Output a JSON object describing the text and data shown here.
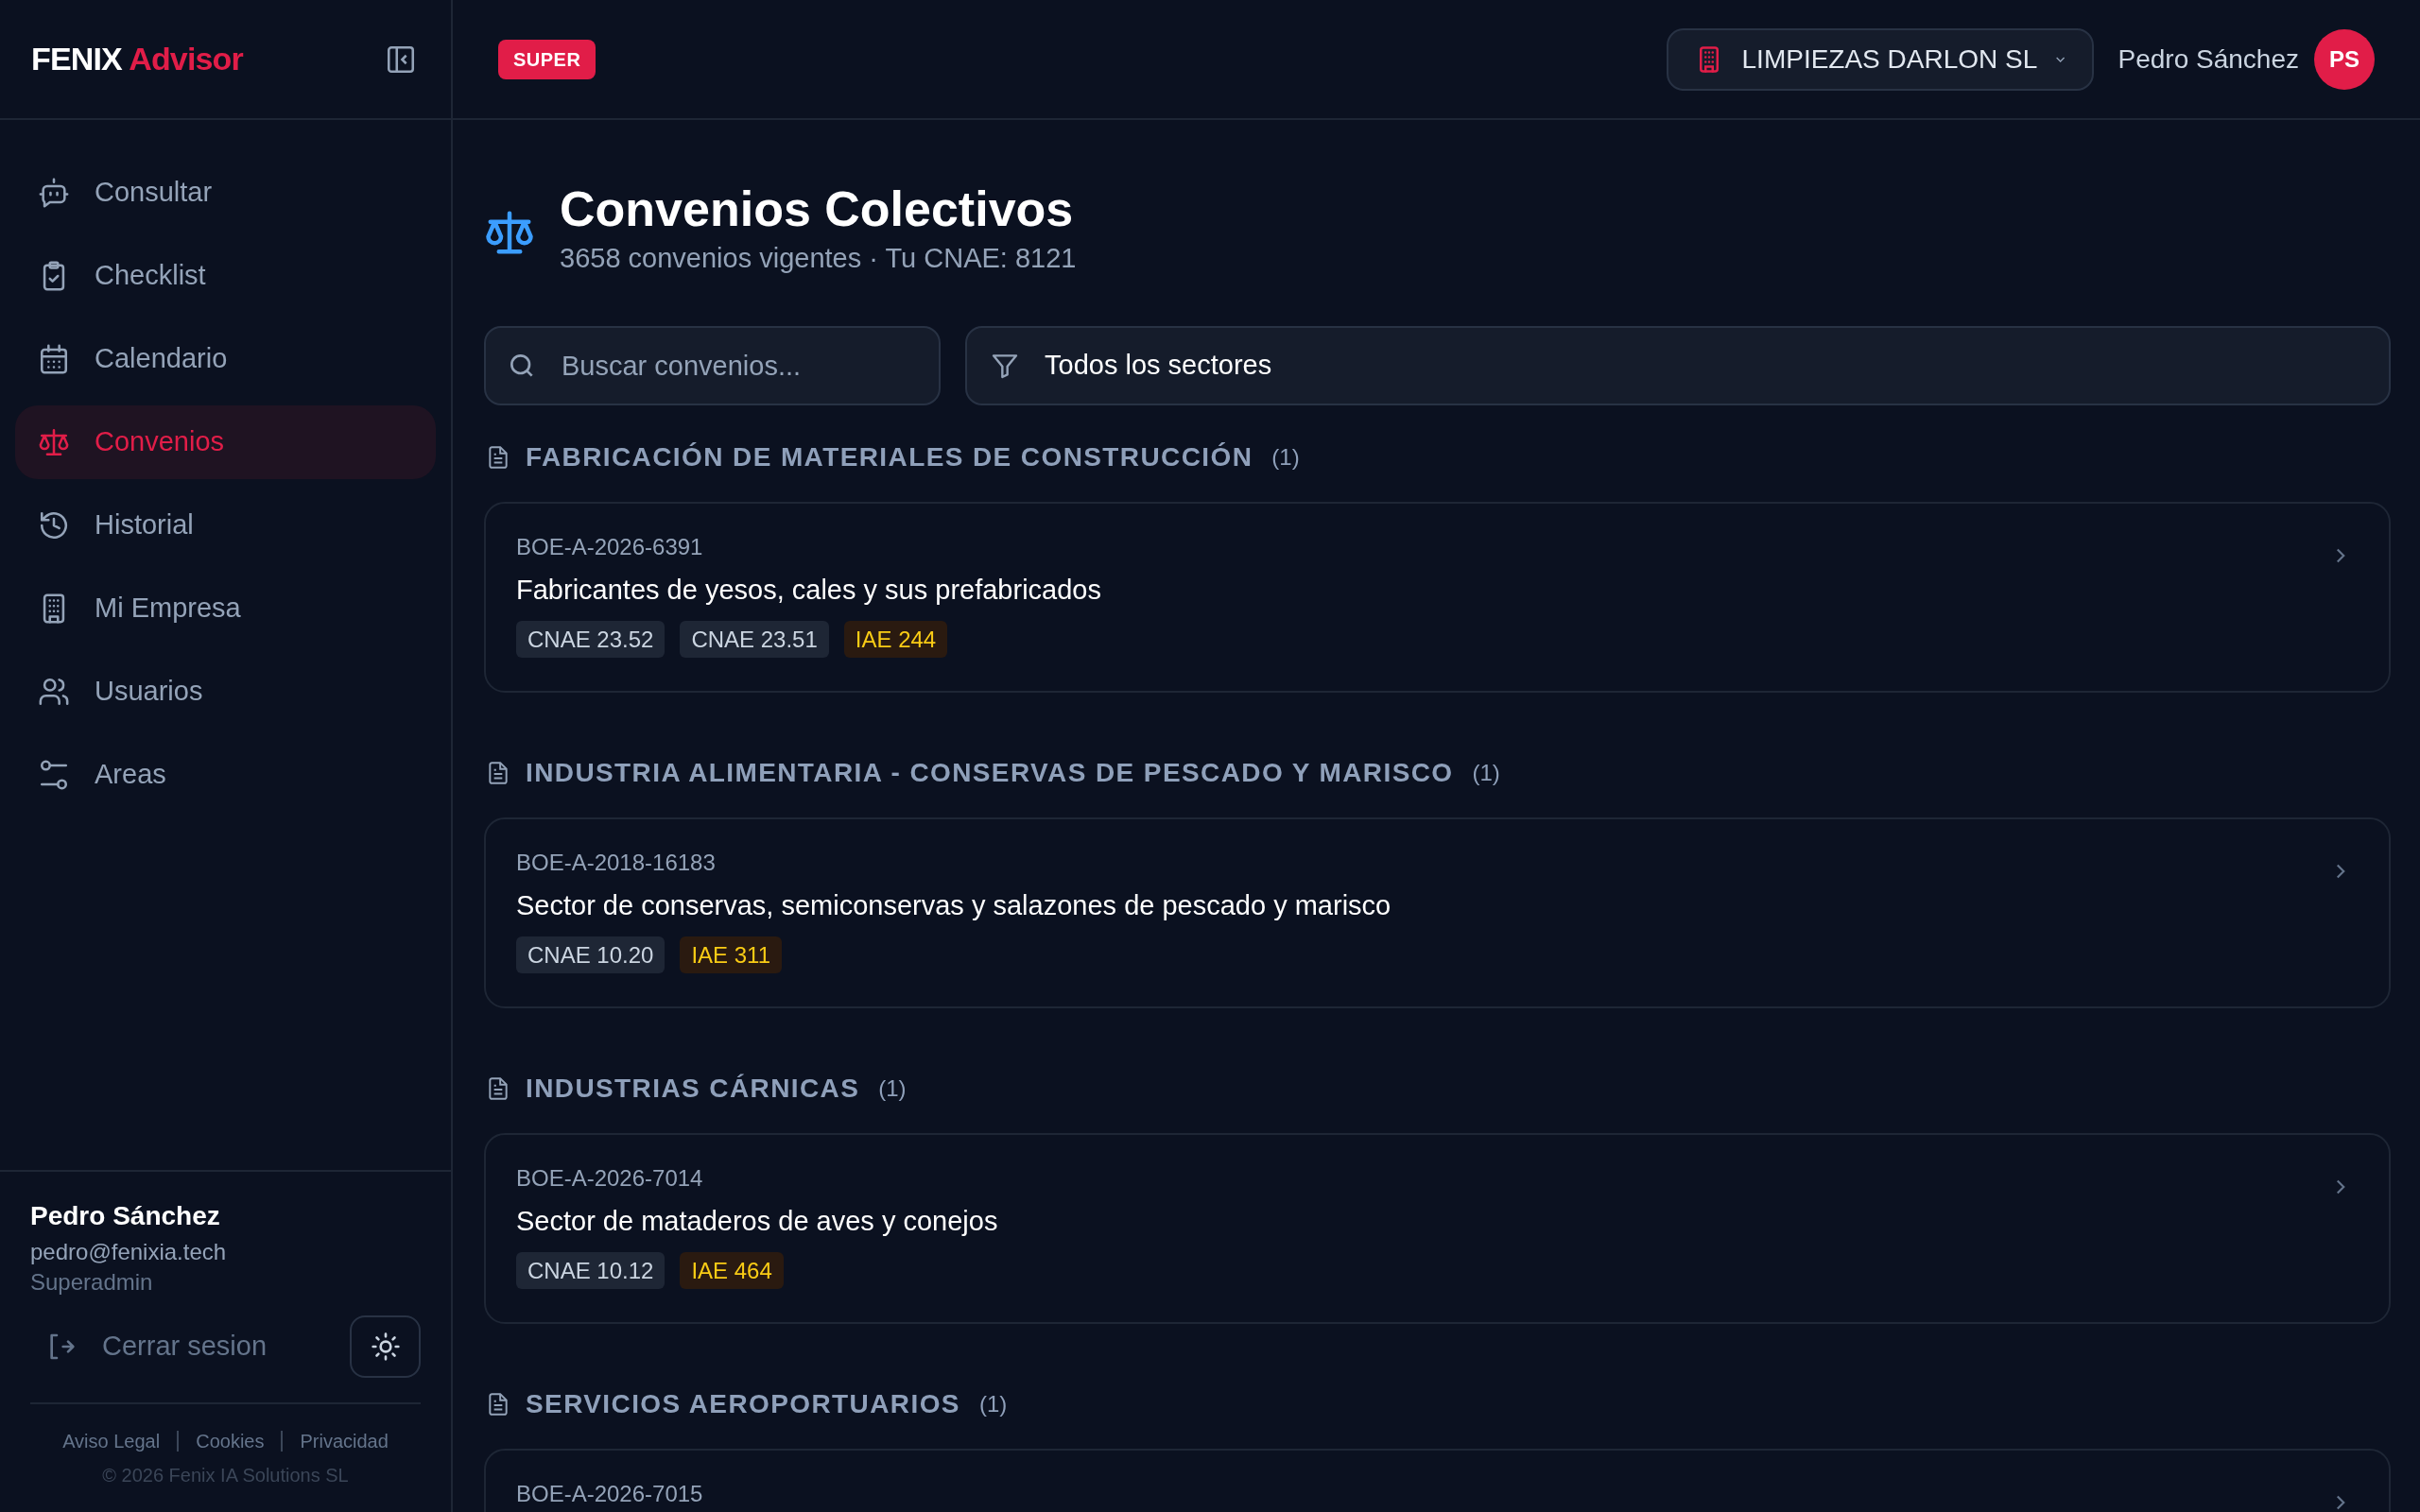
{
  "brand": {
    "first": "FENIX",
    "second": "Advisor"
  },
  "sidebar": {
    "items": [
      {
        "label": "Consultar",
        "selected": false
      },
      {
        "label": "Checklist",
        "selected": false
      },
      {
        "label": "Calendario",
        "selected": false
      },
      {
        "label": "Convenios",
        "selected": true
      },
      {
        "label": "Historial",
        "selected": false
      },
      {
        "label": "Mi Empresa",
        "selected": false
      },
      {
        "label": "Usuarios",
        "selected": false
      },
      {
        "label": "Areas",
        "selected": false
      }
    ],
    "user": {
      "name": "Pedro Sánchez",
      "email": "pedro@fenixia.tech",
      "role": "Superadmin"
    },
    "logout": "Cerrar sesion",
    "footer_links": [
      "Aviso Legal",
      "Cookies",
      "Privacidad"
    ],
    "copyright": "© 2026 Fenix IA Solutions SL"
  },
  "header": {
    "badge": "SUPER",
    "company": "LIMPIEZAS DARLON SL",
    "user_name": "Pedro Sánchez",
    "avatar": "PS"
  },
  "page": {
    "title": "Convenios Colectivos",
    "subtitle": "3658 convenios vigentes · Tu CNAE: 8121",
    "search": {
      "placeholder": "Buscar convenios..."
    },
    "sector_filter": "Todos los sectores",
    "sections": [
      {
        "name": "FABRICACIÓN DE MATERIALES DE CONSTRUCCIÓN",
        "count": "(1)",
        "items": [
          {
            "code": "BOE-A-2026-6391",
            "title": "Fabricantes de yesos, cales y sus prefabricados",
            "tags": [
              {
                "kind": "cnae",
                "text": "CNAE 23.52"
              },
              {
                "kind": "cnae",
                "text": "CNAE 23.51"
              },
              {
                "kind": "iae",
                "text": "IAE 244"
              }
            ]
          }
        ]
      },
      {
        "name": "INDUSTRIA ALIMENTARIA - CONSERVAS DE PESCADO Y MARISCO",
        "count": "(1)",
        "items": [
          {
            "code": "BOE-A-2018-16183",
            "title": "Sector de conservas, semiconservas y salazones de pescado y marisco",
            "tags": [
              {
                "kind": "cnae",
                "text": "CNAE 10.20"
              },
              {
                "kind": "iae",
                "text": "IAE 311"
              }
            ]
          }
        ]
      },
      {
        "name": "INDUSTRIAS CÁRNICAS",
        "count": "(1)",
        "items": [
          {
            "code": "BOE-A-2026-7014",
            "title": "Sector de mataderos de aves y conejos",
            "tags": [
              {
                "kind": "cnae",
                "text": "CNAE 10.12"
              },
              {
                "kind": "iae",
                "text": "IAE 464"
              }
            ]
          }
        ]
      },
      {
        "name": "SERVICIOS AEROPORTUARIOS",
        "count": "(1)",
        "items": [
          {
            "code": "BOE-A-2026-7015"
          }
        ]
      }
    ]
  }
}
